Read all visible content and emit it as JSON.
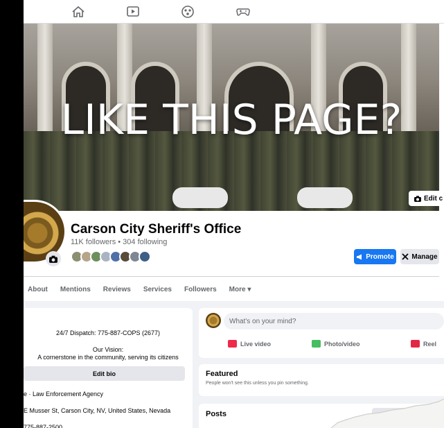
{
  "nav": {
    "icons": [
      "home-icon",
      "video-icon",
      "groups-icon",
      "gaming-icon"
    ]
  },
  "cover": {
    "overlay_text": "LIKE THIS PAGE?",
    "edit_cover_label": "Edit c"
  },
  "profile": {
    "name": "Carson City Sheriff's Office",
    "stats": "11K followers • 304 following",
    "promote_label": "Promote",
    "manage_label": "Manage",
    "brand_color": "#1877f2"
  },
  "tabs": [
    "About",
    "Mentions",
    "Reviews",
    "Services",
    "Followers",
    "More ▾"
  ],
  "intro": {
    "dispatch": "24/7 Dispatch: 775-887-COPS (2677)",
    "vision_title": "Our Vision:",
    "vision_text": "A cornerstone in the community, serving its citizens",
    "edit_bio_label": "Edit bio",
    "category": "e · Law Enforcement Agency",
    "address": "E Musser St, Carson City, NV, United States, Nevada",
    "phone": "775-887-2500"
  },
  "composer": {
    "placeholder": "What's on your mind?",
    "live_video": "Live video",
    "photo_video": "Photo/video",
    "reel": "Reel"
  },
  "featured": {
    "title": "Featured",
    "subtitle": "People won't see this unless you pin something."
  },
  "posts": {
    "title": "Posts"
  }
}
